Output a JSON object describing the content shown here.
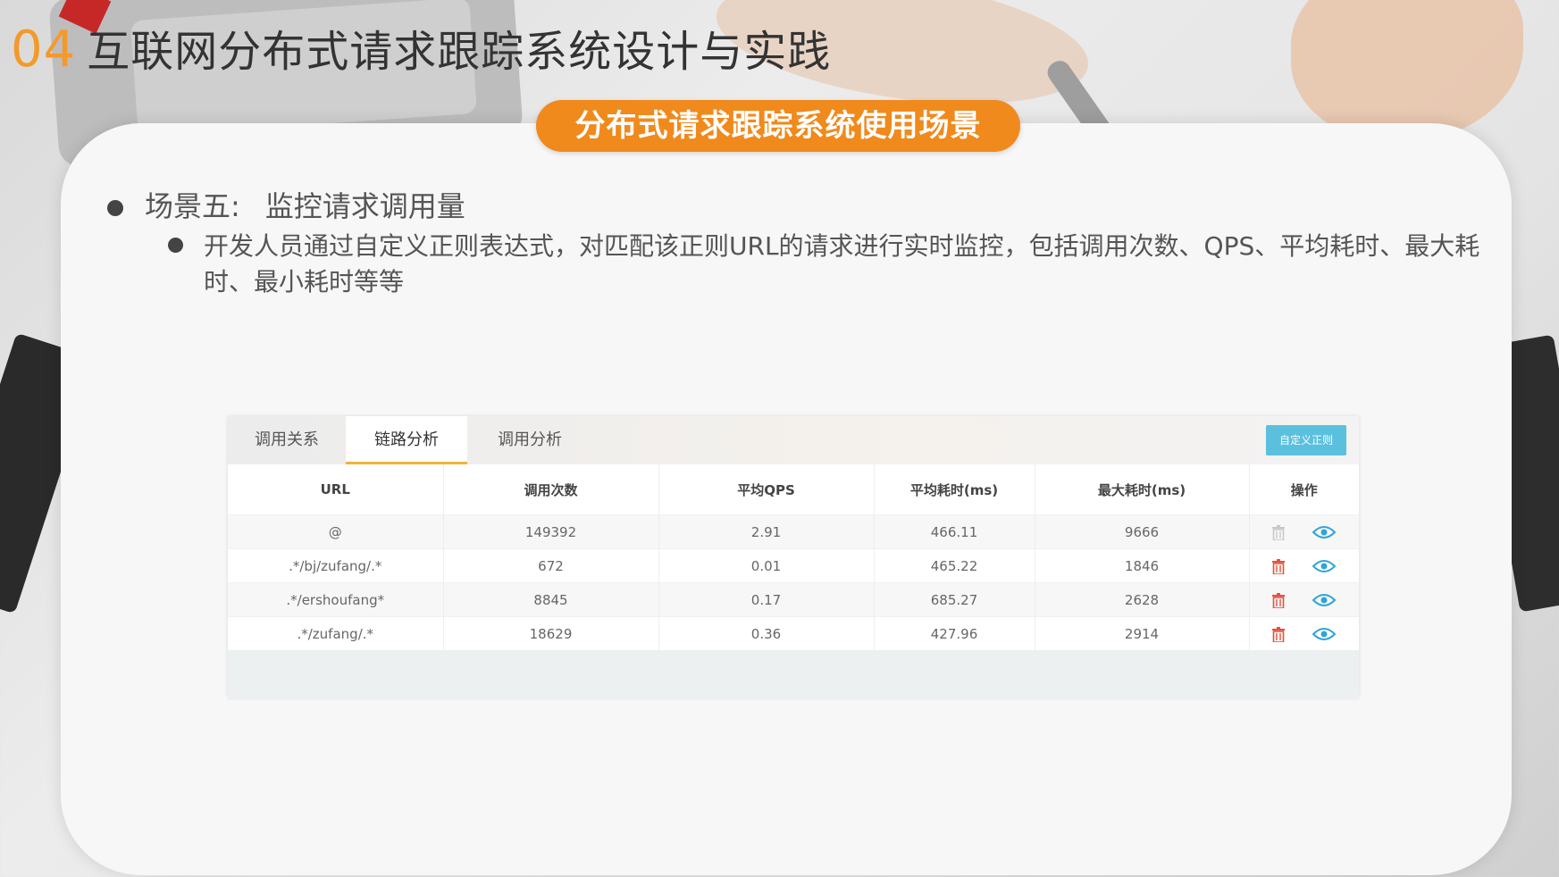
{
  "slide": {
    "number": "04",
    "title": "互联网分布式请求跟踪系统设计与实践",
    "section_pill": "分布式请求跟踪系统使用场景",
    "bullet1_label": "场景五:",
    "bullet1_text": "监控请求调用量",
    "bullet2_text": "开发人员通过自定义正则表达式，对匹配该正则URL的请求进行实时监控，包括调用次数、QPS、平均耗时、最大耗时、最小耗时等等"
  },
  "panel": {
    "tabs": [
      {
        "label": "调用关系",
        "active": false
      },
      {
        "label": "链路分析",
        "active": true
      },
      {
        "label": "调用分析",
        "active": false
      }
    ],
    "custom_button": "自定义正则",
    "columns": [
      "URL",
      "调用次数",
      "平均QPS",
      "平均耗时(ms)",
      "最大耗时(ms)",
      "操作"
    ],
    "rows": [
      {
        "url": "@",
        "calls": "149392",
        "qps": "2.91",
        "avg": "466.11",
        "max": "9666",
        "delete_enabled": false
      },
      {
        "url": ".*/bj/zufang/.*",
        "calls": "672",
        "qps": "0.01",
        "avg": "465.22",
        "max": "1846",
        "delete_enabled": true
      },
      {
        "url": ".*/ershoufang*",
        "calls": "8845",
        "qps": "0.17",
        "avg": "685.27",
        "max": "2628",
        "delete_enabled": true
      },
      {
        "url": ".*/zufang/.*",
        "calls": "18629",
        "qps": "0.36",
        "avg": "427.96",
        "max": "2914",
        "delete_enabled": true
      }
    ],
    "icons": {
      "delete": "trash-icon",
      "view": "eye-icon"
    },
    "colors": {
      "delete_active": "#e8503a",
      "delete_disabled": "#c8c8c8",
      "view": "#2fa4d6",
      "tab_underline": "#f0b43a",
      "button": "#5bc0de"
    }
  },
  "colors": {
    "accent_orange": "#f08a1c",
    "number_orange": "#f39a2b"
  }
}
